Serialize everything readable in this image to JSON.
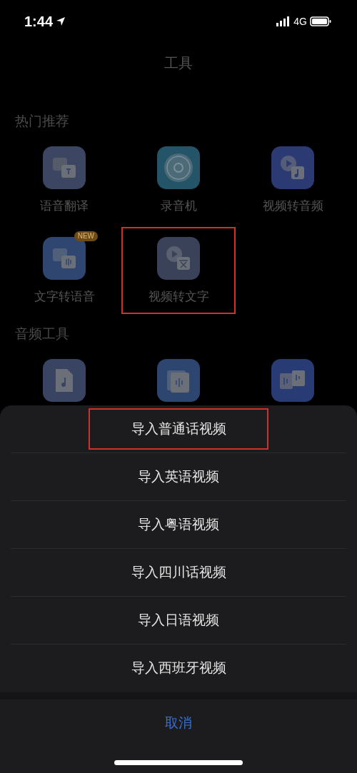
{
  "status_bar": {
    "time": "1:44",
    "network": "4G"
  },
  "title": "工具",
  "sections": [
    {
      "heading": "热门推荐",
      "tools": [
        {
          "kind": "translate",
          "label": "语音翻译",
          "highlighted": false
        },
        {
          "kind": "record",
          "label": "录音机",
          "highlighted": false
        },
        {
          "kind": "video-audio",
          "label": "视频转音频",
          "highlighted": false
        },
        {
          "kind": "text-speech",
          "label": "文字转语音",
          "badge": "NEW",
          "highlighted": false
        },
        {
          "kind": "video-text",
          "label": "视频转文字",
          "highlighted": true
        }
      ]
    },
    {
      "heading": "音频工具",
      "tools": [
        {
          "kind": "audio-file",
          "highlighted": false
        },
        {
          "kind": "waveform",
          "highlighted": false
        },
        {
          "kind": "audio-split",
          "highlighted": false
        }
      ]
    }
  ],
  "action_sheet": {
    "options": [
      {
        "label": "导入普通话视频",
        "highlighted": true
      },
      {
        "label": "导入英语视频",
        "highlighted": false
      },
      {
        "label": "导入粤语视频",
        "highlighted": false
      },
      {
        "label": "导入四川话视频",
        "highlighted": false
      },
      {
        "label": "导入日语视频",
        "highlighted": false
      },
      {
        "label": "导入西班牙视频",
        "highlighted": false
      }
    ],
    "cancel": "取消"
  }
}
